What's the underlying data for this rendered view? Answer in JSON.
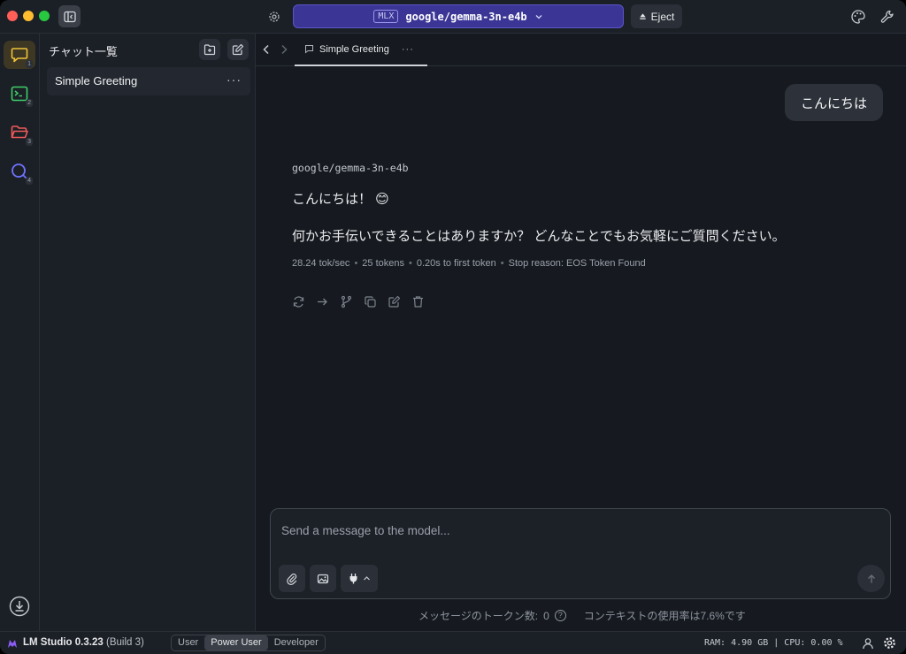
{
  "titlebar": {
    "model_badge": "MLX",
    "model_name": "google/gemma-3n-e4b",
    "eject_label": "Eject"
  },
  "rail": {
    "items": [
      {
        "name": "chat",
        "num": "1"
      },
      {
        "name": "developer",
        "num": "2"
      },
      {
        "name": "my-models",
        "num": "3"
      },
      {
        "name": "discover",
        "num": "4"
      }
    ]
  },
  "chatlist": {
    "title": "チャット一覧",
    "items": [
      {
        "label": "Simple Greeting",
        "more": "···"
      }
    ]
  },
  "tabbar": {
    "tabs": [
      {
        "label": "Simple Greeting",
        "more": "···"
      }
    ]
  },
  "conversation": {
    "user_message": "こんにちは",
    "assistant": {
      "model": "google/gemma-3n-e4b",
      "line1": "こんにちは！ 😊",
      "line2": "何かお手伝いできることはありますか？ どんなことでもお気軽にご質問ください。",
      "stats": {
        "speed": "28.24 tok/sec",
        "tokens": "25 tokens",
        "first_token": "0.20s to first token",
        "stop_reason": "Stop reason: EOS Token Found"
      }
    }
  },
  "composer": {
    "placeholder": "Send a message to the model...",
    "token_count_label": "メッセージのトークン数:",
    "token_count": "0",
    "help": "?",
    "context_usage": "コンテキストの使用率は7.6%です"
  },
  "statusbar": {
    "app_name": "LM Studio 0.3.23",
    "build": "(Build 3)",
    "modes": [
      "User",
      "Power User",
      "Developer"
    ],
    "active_mode": "Power User",
    "sys_info": "RAM: 4.90 GB  |  CPU: 0.00 %"
  },
  "colors": {
    "accent_model_pill": "#3b3696",
    "active_rail_bg": "#3d3724",
    "chat_icon": "#f0c43a",
    "terminal_icon": "#3fcf6a",
    "folder_icon": "#ef5a5a",
    "search_icon": "#6f73ff"
  }
}
